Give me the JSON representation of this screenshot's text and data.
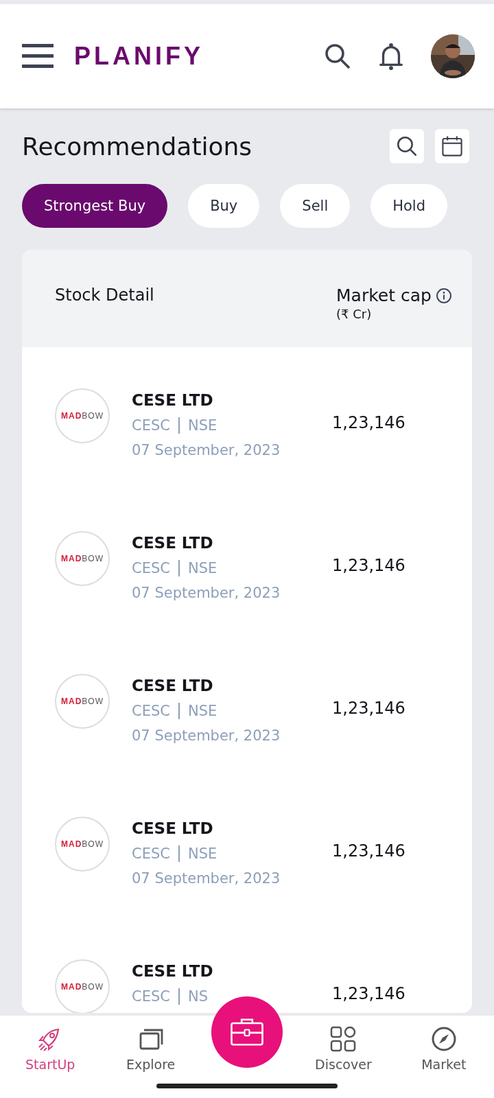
{
  "header": {
    "logo": "PLANIFY"
  },
  "page": {
    "title": "Recommendations"
  },
  "tabs": [
    {
      "label": "Strongest Buy",
      "selected": true
    },
    {
      "label": "Buy",
      "selected": false
    },
    {
      "label": "Sell",
      "selected": false
    },
    {
      "label": "Hold",
      "selected": false
    }
  ],
  "table": {
    "columns": [
      {
        "label": "Stock Detail"
      },
      {
        "label": "Market cap",
        "sub": "(₹ Cr)",
        "info": true
      }
    ],
    "rows": [
      {
        "logo_strong": "MAD",
        "logo_light": "BOW",
        "name": "CESE LTD",
        "symbol": "CESC",
        "exchange": "NSE",
        "date": "07 September, 2023",
        "market_cap": "1,23,146"
      },
      {
        "logo_strong": "MAD",
        "logo_light": "BOW",
        "name": "CESE LTD",
        "symbol": "CESC",
        "exchange": "NSE",
        "date": "07 September, 2023",
        "market_cap": "1,23,146"
      },
      {
        "logo_strong": "MAD",
        "logo_light": "BOW",
        "name": "CESE LTD",
        "symbol": "CESC",
        "exchange": "NSE",
        "date": "07 September, 2023",
        "market_cap": "1,23,146"
      },
      {
        "logo_strong": "MAD",
        "logo_light": "BOW",
        "name": "CESE LTD",
        "symbol": "CESC",
        "exchange": "NSE",
        "date": "07 September, 2023",
        "market_cap": "1,23,146"
      },
      {
        "logo_strong": "MAD",
        "logo_light": "BOW",
        "name": "CESE LTD",
        "symbol": "CESC",
        "exchange": "NS",
        "market_cap": "1,23,146"
      }
    ]
  },
  "bottom_nav": [
    {
      "kind": "rocket",
      "label": "StartUp",
      "selected": true
    },
    {
      "kind": "windows",
      "label": "Explore",
      "selected": false
    },
    {
      "kind": "fab"
    },
    {
      "kind": "grid",
      "label": "Discover",
      "selected": false
    },
    {
      "kind": "compass",
      "label": "Market",
      "selected": false
    }
  ]
}
